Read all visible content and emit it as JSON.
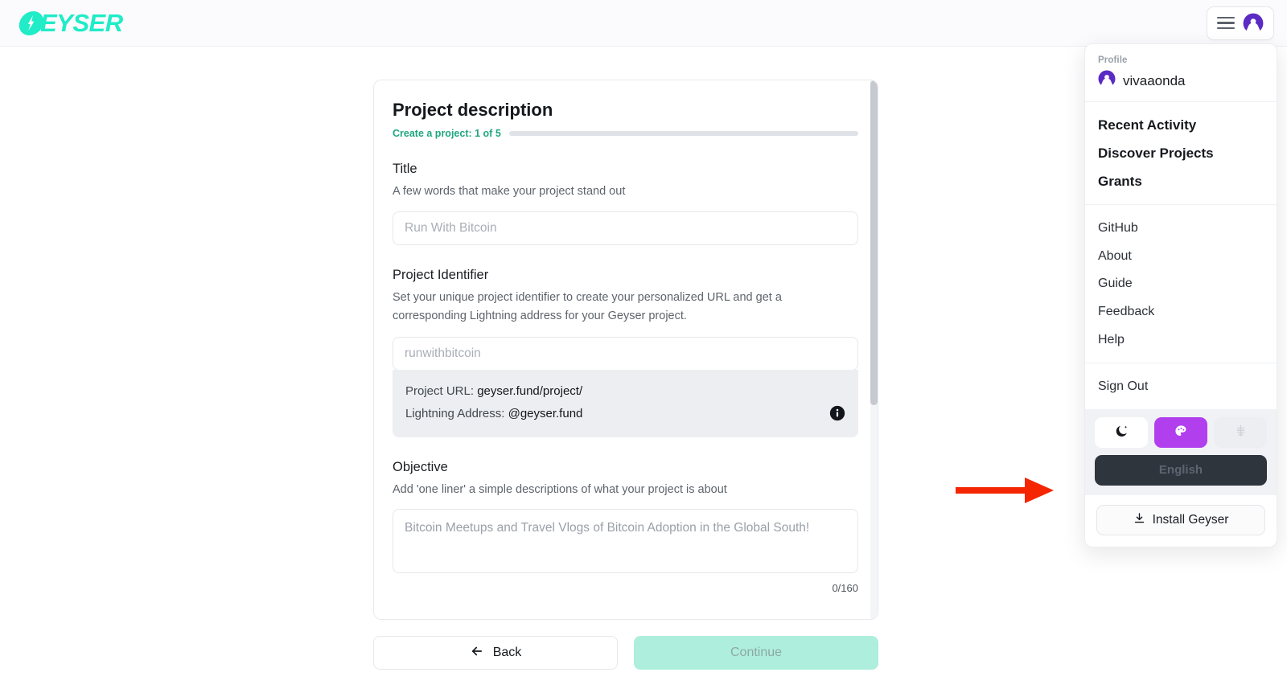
{
  "header": {
    "logo_text": "EYSER",
    "logo_icon": "lightning-bolt-circle-icon",
    "menu_icon": "hamburger-menu-icon",
    "avatar_icon": "user-avatar-icon"
  },
  "dropdown": {
    "profile_label": "Profile",
    "username": "vivaaonda",
    "primary_items": [
      {
        "label": "Recent Activity"
      },
      {
        "label": "Discover Projects"
      },
      {
        "label": "Grants"
      }
    ],
    "secondary_items": [
      {
        "label": "GitHub"
      },
      {
        "label": "About"
      },
      {
        "label": "Guide"
      },
      {
        "label": "Feedback"
      },
      {
        "label": "Help"
      }
    ],
    "sign_out": "Sign Out",
    "theme_buttons": [
      {
        "icon": "moon-dark-mode-icon"
      },
      {
        "icon": "palette-theme-icon"
      },
      {
        "icon": "geyser-fountain-icon"
      }
    ],
    "language": "English",
    "install_label": "Install Geyser",
    "install_icon": "download-icon",
    "accent_color": "#b13fee",
    "language_bg_color": "#2e353d"
  },
  "card": {
    "title": "Project description",
    "progress_label": "Create a project: 1 of 5",
    "progress_percent": 20,
    "progress_color": "#20a17f",
    "fields": {
      "title": {
        "label": "Title",
        "hint": "A few words that make your project stand out",
        "placeholder": "Run With Bitcoin",
        "value": ""
      },
      "identifier": {
        "label": "Project Identifier",
        "hint": "Set your unique project identifier to create your personalized URL and get a corresponding Lightning address for your Geyser project.",
        "placeholder": "runwithbitcoin",
        "value": "",
        "project_url_label": "Project URL:",
        "project_url_value": "geyser.fund/project/",
        "lightning_label": "Lightning Address:",
        "lightning_value": "@geyser.fund",
        "info_icon": "info-circle-icon"
      },
      "objective": {
        "label": "Objective",
        "hint": "Add 'one liner' a simple descriptions of what your project is about",
        "placeholder": "Bitcoin Meetups and Travel Vlogs of Bitcoin Adoption in the Global South!",
        "value": "",
        "char_count": "0/160"
      }
    }
  },
  "footer": {
    "back_label": "Back",
    "back_icon": "arrow-left-icon",
    "continue_label": "Continue",
    "continue_color": "#aeeedd"
  },
  "annotation": {
    "arrow_color": "#f42500",
    "points_to": "language-selector-button"
  }
}
